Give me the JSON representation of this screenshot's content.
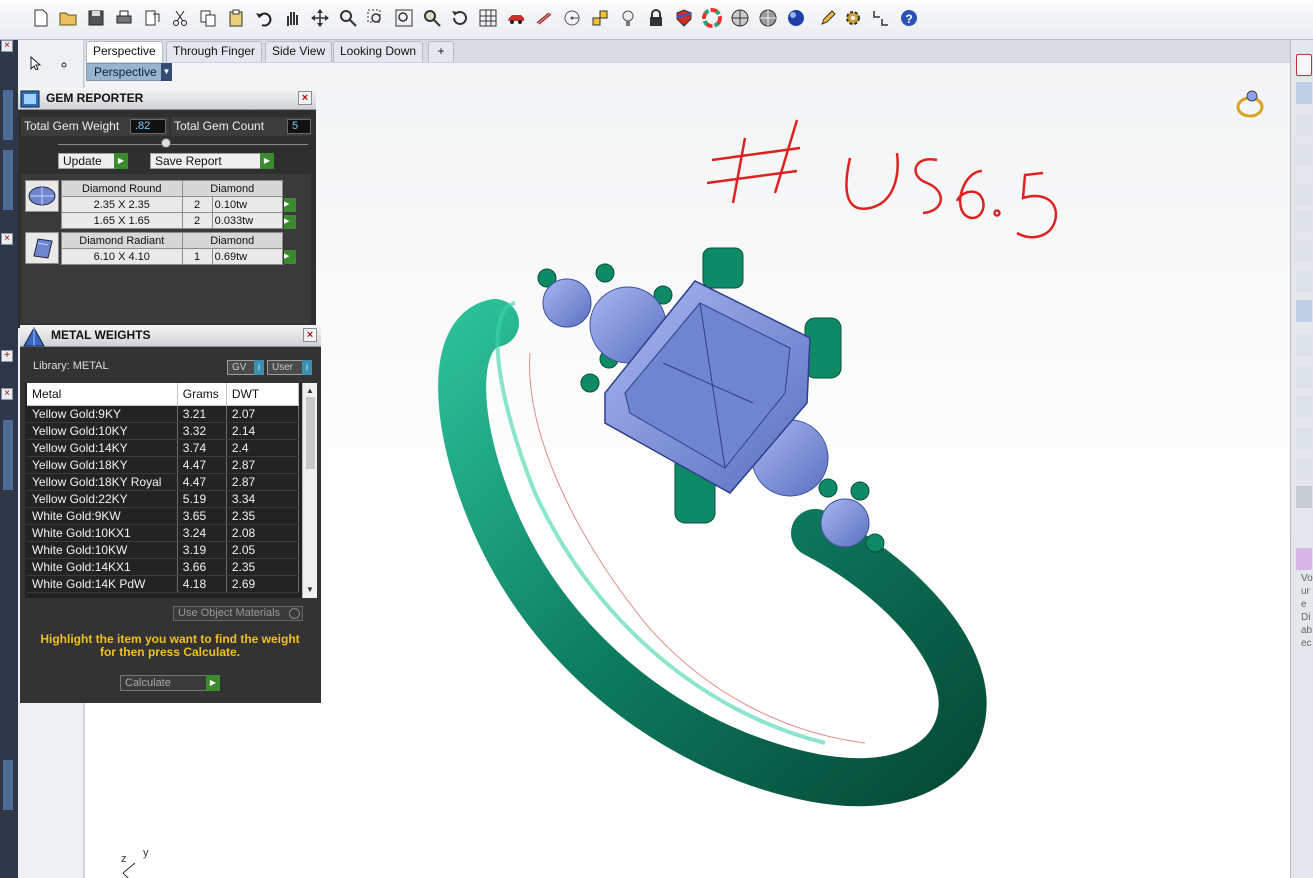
{
  "toolbar": {
    "icons": [
      "new-file-icon",
      "open-folder-icon",
      "save-icon",
      "print-icon",
      "export-icon",
      "cut-icon",
      "copy-icon",
      "paste-icon",
      "undo-icon",
      "pan-hand-icon",
      "move-icon",
      "zoom-icon",
      "zoom-window-icon",
      "zoom-extents-icon",
      "zoom-selected-icon",
      "rotate-view-icon",
      "grid-icon",
      "car-icon",
      "sketch-icon",
      "snap-icon",
      "object-snap-icon",
      "light-bulb-icon",
      "lock-icon",
      "shield-icon",
      "color-wheel-icon",
      "render-wire-icon",
      "render-shade-icon",
      "render-ghost-icon",
      "render-full-icon",
      "pencil-icon",
      "gear-icon",
      "history-icon",
      "help-icon"
    ]
  },
  "tabs": [
    {
      "label": "Perspective",
      "active": true
    },
    {
      "label": "Through Finger",
      "active": false
    },
    {
      "label": "Side View",
      "active": false
    },
    {
      "label": "Looking Down",
      "active": false
    }
  ],
  "sub_view": {
    "label": "Perspective"
  },
  "gem_reporter": {
    "title": "GEM REPORTER",
    "total_weight_label": "Total Gem Weight",
    "total_weight_value": ".82",
    "total_count_label": "Total Gem Count",
    "total_count_value": "5",
    "update_label": "Update",
    "save_report_label": "Save Report",
    "groups": [
      {
        "name": "Diamond Round",
        "material": "Diamond",
        "icon": "round-gem-icon",
        "rows": [
          {
            "size": "2.35 X 2.35",
            "qty": "2",
            "weight": "0.10tw"
          },
          {
            "size": "1.65 X 1.65",
            "qty": "2",
            "weight": "0.033tw"
          }
        ]
      },
      {
        "name": "Diamond Radiant",
        "material": "Diamond",
        "icon": "radiant-gem-icon",
        "rows": [
          {
            "size": "6.10 X 4.10",
            "qty": "1",
            "weight": "0.69tw"
          }
        ]
      }
    ]
  },
  "metal_weights": {
    "title": "METAL WEIGHTS",
    "library_label": "Library: METAL",
    "gv_label": "GV",
    "user_label": "User",
    "columns": [
      "Metal",
      "Grams",
      "DWT"
    ],
    "rows": [
      {
        "metal": "Yellow Gold:9KY",
        "grams": "3.21",
        "dwt": "2.07"
      },
      {
        "metal": "Yellow Gold:10KY",
        "grams": "3.32",
        "dwt": "2.14"
      },
      {
        "metal": "Yellow Gold:14KY",
        "grams": "3.74",
        "dwt": "2.4"
      },
      {
        "metal": "Yellow Gold:18KY",
        "grams": "4.47",
        "dwt": "2.87"
      },
      {
        "metal": "Yellow Gold:18KY Royal",
        "grams": "4.47",
        "dwt": "2.87"
      },
      {
        "metal": "Yellow Gold:22KY",
        "grams": "5.19",
        "dwt": "3.34"
      },
      {
        "metal": "White Gold:9KW",
        "grams": "3.65",
        "dwt": "2.35"
      },
      {
        "metal": "White Gold:10KX1",
        "grams": "3.24",
        "dwt": "2.08"
      },
      {
        "metal": "White Gold:10KW",
        "grams": "3.19",
        "dwt": "2.05"
      },
      {
        "metal": "White Gold:14KX1",
        "grams": "3.66",
        "dwt": "2.35"
      },
      {
        "metal": "White Gold:14K PdW",
        "grams": "4.18",
        "dwt": "2.69"
      }
    ],
    "use_object_materials_label": "Use Object Materials",
    "instruction": "Highlight the item you want to find the weight for then press Calculate.",
    "calculate_label": "Calculate"
  },
  "viewport": {
    "annotation": "# US 6.5",
    "axis_z": "z",
    "axis_y": "y",
    "colors": {
      "metal": "#0e8a68",
      "gem": "#7d92dc",
      "annotation": "#d22"
    }
  },
  "right_rail_text": [
    "Vo",
    "ur",
    "e",
    "Di",
    "ab",
    "ec"
  ]
}
